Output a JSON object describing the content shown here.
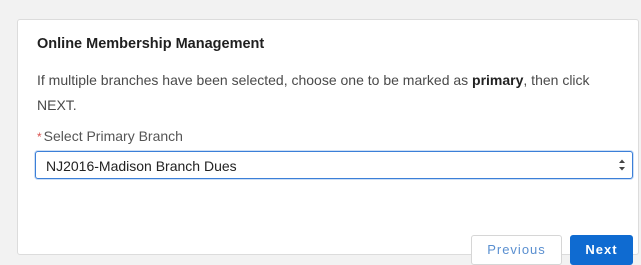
{
  "card": {
    "title": "Online Membership Management",
    "description_before": "If multiple branches have been selected, choose one to be marked as ",
    "description_bold": "primary",
    "description_after": ", then click NEXT."
  },
  "form": {
    "required_marker": "*",
    "label": "Select Primary Branch",
    "selected_value": "NJ2016-Madison Branch Dues"
  },
  "buttons": {
    "previous": "Previous",
    "next": "Next"
  },
  "colors": {
    "accent": "#0f6bd1",
    "required": "#d9534f",
    "focus_border": "#3b7fd8"
  },
  "icons": {
    "select_arrows": "updown-chevron-icon"
  }
}
